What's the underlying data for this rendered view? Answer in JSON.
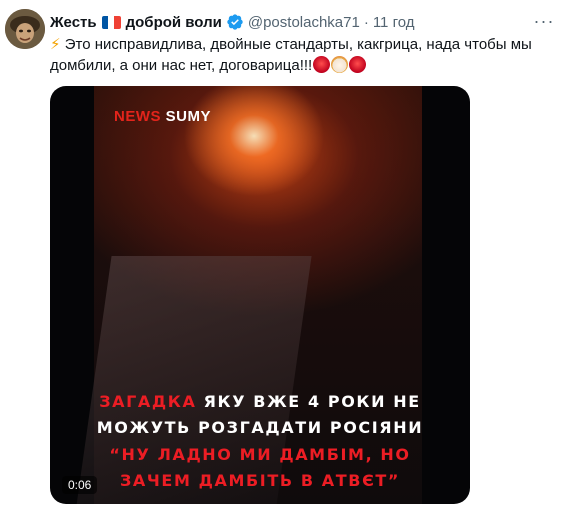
{
  "tweet": {
    "display_name": "Жесть",
    "display_name_suffix": "доброй воли",
    "handle": "@postolachka71",
    "separator": "·",
    "time": "11 год",
    "text": "Это ниспрaвидлива, двойные стандарты, какгрица, нада чтобы мы домбили, а они нас нет, договарица!!!"
  },
  "media": {
    "badge_news": "NEWS",
    "badge_sumy": "SUMY",
    "caption": {
      "line1_red": "ЗАГАДКА",
      "line1_white": " ЯКУ ВЖЕ 4 РОКИ НЕ",
      "line2": "МОЖУТЬ РОЗГАДАТИ РОСІЯНИ",
      "line3": "“НУ ЛАДНО МИ ДАМБІМ, НО",
      "line4": "ЗАЧЕМ ДАМБІТЬ В АТВЄТ”"
    },
    "timestamp": "0:06"
  },
  "icons": {
    "flag": "france-flag-icon",
    "verified": "verified-badge-icon",
    "more": "more-options-icon",
    "zap": "high-voltage-emoji",
    "emoji_1": "face-with-symbols-emoji",
    "emoji_2": "clown-face-emoji",
    "emoji_3": "face-with-symbols-emoji"
  },
  "colors": {
    "verified": "#1d9bf0",
    "caption_red": "#ec1d24",
    "news_red": "#e3241b"
  }
}
